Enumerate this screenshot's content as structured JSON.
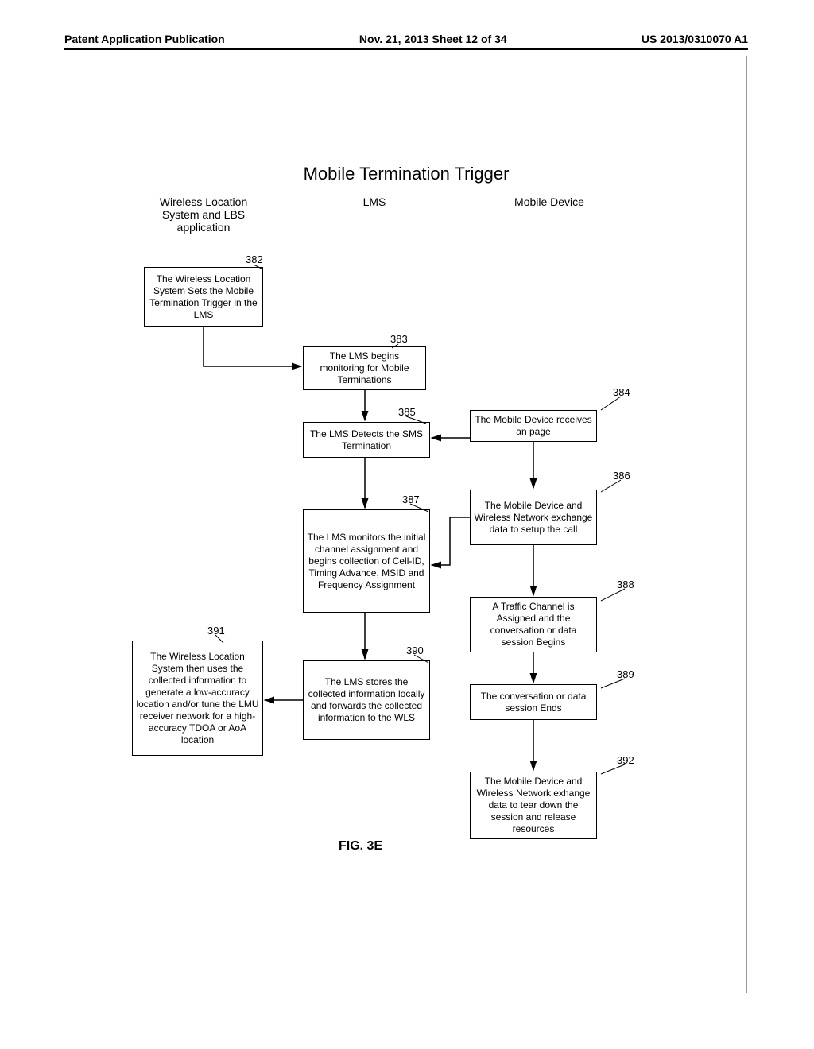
{
  "header": {
    "left": "Patent Application Publication",
    "center": "Nov. 21, 2013   Sheet 12 of 34",
    "right": "US 2013/0310070 A1"
  },
  "title": "Mobile Termination Trigger",
  "columns": {
    "wls": "Wireless Location\nSystem and LBS\napplication",
    "lms": "LMS",
    "mobile": "Mobile Device"
  },
  "boxes": {
    "b382": "The Wireless Location System Sets the Mobile Termination Trigger in the LMS",
    "b383": "The LMS begins monitoring for Mobile Terminations",
    "b384": "The Mobile Device receives an page",
    "b385": "The LMS Detects the SMS Termination",
    "b386": "The Mobile Device and Wireless Network exchange data to setup the call",
    "b387": "The LMS monitors the initial channel assignment and begins collection of Cell-ID, Timing Advance, MSID and Frequency Assignment",
    "b388": "A Traffic Channel is Assigned and the conversation or data session Begins",
    "b389": "The conversation or data session Ends",
    "b390": "The LMS stores the collected information locally and forwards the collected information to the WLS",
    "b391": "The Wireless Location System then uses the collected information to generate a low-accuracy location and/or tune the LMU receiver network for a high-accuracy TDOA or AoA location",
    "b392": "The Mobile Device and Wireless Network exhange data to tear down the session and release resources"
  },
  "refs": {
    "r382": "382",
    "r383": "383",
    "r384": "384",
    "r385": "385",
    "r386": "386",
    "r387": "387",
    "r388": "388",
    "r389": "389",
    "r390": "390",
    "r391": "391",
    "r392": "392"
  },
  "figure_label": "FIG. 3E"
}
